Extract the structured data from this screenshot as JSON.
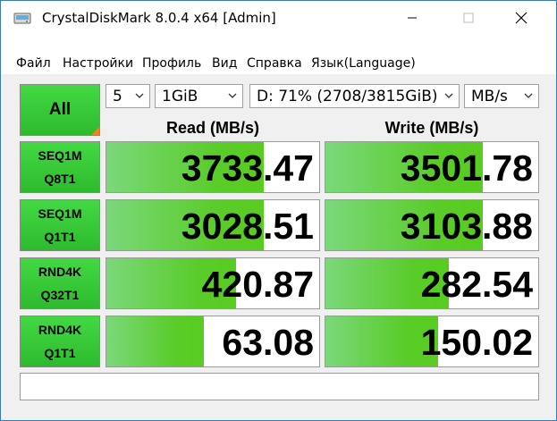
{
  "window": {
    "title": "CrystalDiskMark 8.0.4 x64 [Admin]"
  },
  "menu": [
    "Файл",
    "Настройки",
    "Профиль",
    "Вид",
    "Справка",
    "Язык(Language)"
  ],
  "controls": {
    "all_label": "All",
    "count": "5",
    "size": "1GiB",
    "drive": "D: 71% (2708/3815GiB)",
    "unit": "MB/s"
  },
  "headers": {
    "read": "Read (MB/s)",
    "write": "Write (MB/s)"
  },
  "tests": [
    {
      "line1": "SEQ1M",
      "line2": "Q8T1",
      "read": "3733.47",
      "write": "3501.78",
      "read_fill": 0.74,
      "write_fill": 0.74
    },
    {
      "line1": "SEQ1M",
      "line2": "Q1T1",
      "read": "3028.51",
      "write": "3103.88",
      "read_fill": 0.74,
      "write_fill": 0.74
    },
    {
      "line1": "RND4K",
      "line2": "Q32T1",
      "read": "420.87",
      "write": "282.54",
      "read_fill": 0.61,
      "write_fill": 0.58
    },
    {
      "line1": "RND4K",
      "line2": "Q1T1",
      "read": "63.08",
      "write": "150.02",
      "read_fill": 0.46,
      "write_fill": 0.53
    }
  ],
  "status_text": "",
  "colors": {
    "accent_green": "#2dbb2d",
    "bar_green": "#58cc20",
    "corner_orange": "#f08020",
    "border_blue": "#3a7ab5"
  }
}
